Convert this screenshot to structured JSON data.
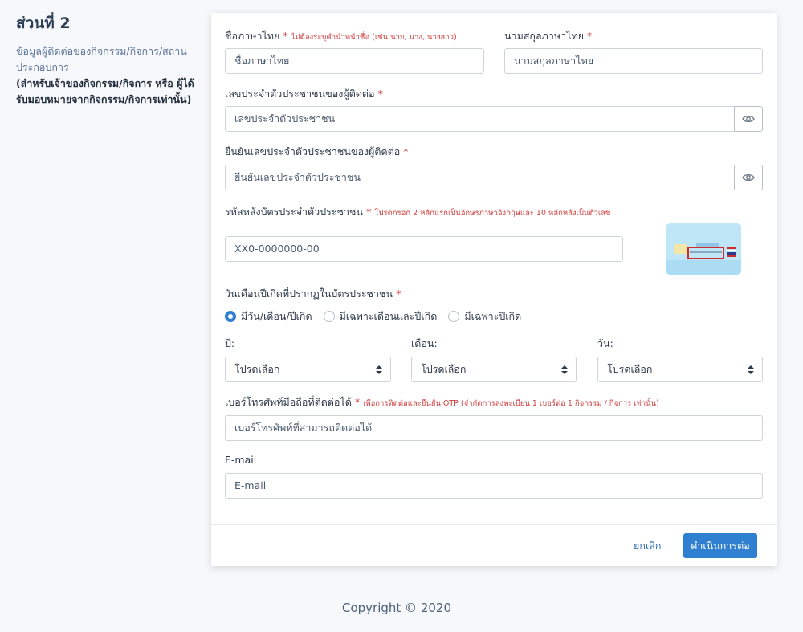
{
  "section": {
    "title": "ส่วนที่ 2",
    "description": "ข้อมูลผู้ติดต่อของกิจกรรม/กิจการ/สถานประกอบการ",
    "note": "(สำหรับเจ้าของกิจกรรม/กิจการ หรือ ผู้ได้รับมอบหมายจากกิจกรรม/กิจการเท่านั้น)"
  },
  "form": {
    "first_name": {
      "label": "ชื่อภาษาไทย",
      "required": "*",
      "note": "ไม่ต้องระบุคำนำหน้าชื่อ (เช่น นาย, นาง, นางสาว)",
      "placeholder": "ชื่อภาษาไทย"
    },
    "last_name": {
      "label": "นามสกุลภาษาไทย",
      "required": "*",
      "placeholder": "นามสกุลภาษาไทย"
    },
    "id_number": {
      "label": "เลขประจำตัวประชาชนของผู้ติดต่อ",
      "required": "*",
      "placeholder": "เลขประจำตัวประชาชน"
    },
    "id_confirm": {
      "label": "ยืนยันเลขประจำตัวประชาชนของผู้ติดต่อ",
      "required": "*",
      "placeholder": "ยืนยันเลขประจำตัวประชาชน"
    },
    "laser_code": {
      "label": "รหัสหลังบัตรประจำตัวประชาชน",
      "required": "*",
      "note": "โปรดกรอก 2 หลักแรกเป็นอักษรภาษาอังกฤษและ 10 หลักหลังเป็นตัวเลข",
      "placeholder": "XX0-0000000-00"
    },
    "birth_date": {
      "label": "วันเดือนปีเกิดที่ปรากฏในบัตรประชาชน",
      "required": "*",
      "options": [
        "มีวัน/เดือน/ปีเกิด",
        "มีเฉพาะเดือนและปีเกิด",
        "มีเฉพาะปีเกิด"
      ],
      "selected_index": 0,
      "year_label": "ปี:",
      "month_label": "เดือน:",
      "day_label": "วัน:",
      "select_value": "โปรดเลือก"
    },
    "phone": {
      "label": "เบอร์โทรศัพท์มือถือที่ติดต่อได้",
      "required": "*",
      "note": "เพื่อการติดต่อและยืนยัน OTP (จำกัดการลงทะเบียน 1 เบอร์ต่อ 1 กิจกรรม / กิจการ เท่านั้น)",
      "placeholder": "เบอร์โทรศัพท์ที่สามารถติดต่อได้"
    },
    "email": {
      "label": "E-mail",
      "placeholder": "E-mail"
    },
    "cancel_label": "ยกเลิก",
    "submit_label": "ดำเนินการต่อ"
  },
  "footer": {
    "copyright": "Copyright © 2020"
  },
  "colors": {
    "primary": "#2f80d0",
    "required": "#d13d3d",
    "background": "#f7f8fb"
  },
  "icons": {
    "show_password": "eye-icon",
    "select_caret": "sort-caret-icon",
    "id_card_back": "id-card-illustration"
  }
}
